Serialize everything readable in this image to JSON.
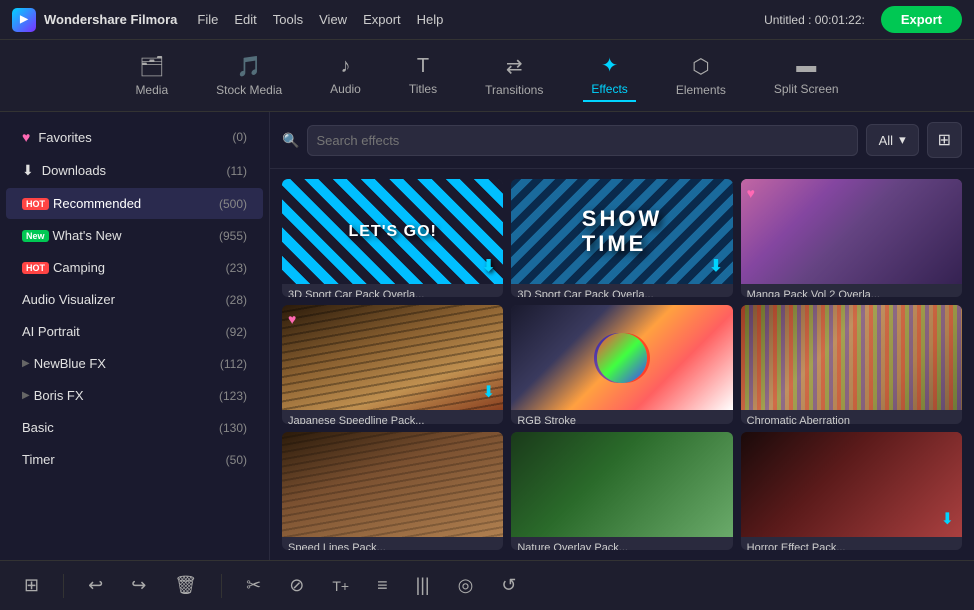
{
  "titleBar": {
    "appName": "Wondershare Filmora",
    "menuItems": [
      "File",
      "Edit",
      "Tools",
      "View",
      "Export",
      "Help"
    ],
    "projectTitle": "Untitled : 00:01:22:",
    "exportLabel": "Export"
  },
  "toolbar": {
    "items": [
      {
        "id": "media",
        "label": "Media",
        "icon": "☰"
      },
      {
        "id": "stock-media",
        "label": "Stock Media",
        "icon": "🎵"
      },
      {
        "id": "audio",
        "label": "Audio",
        "icon": "♪"
      },
      {
        "id": "titles",
        "label": "Titles",
        "icon": "T"
      },
      {
        "id": "transitions",
        "label": "Transitions",
        "icon": "⇄"
      },
      {
        "id": "effects",
        "label": "Effects",
        "icon": "✦",
        "active": true
      },
      {
        "id": "elements",
        "label": "Elements",
        "icon": "⬡"
      },
      {
        "id": "split-screen",
        "label": "Split Screen",
        "icon": "⬜"
      }
    ]
  },
  "sidebar": {
    "items": [
      {
        "id": "favorites",
        "label": "Favorites",
        "count": "(0)",
        "icon": "♥"
      },
      {
        "id": "downloads",
        "label": "Downloads",
        "count": "(11)",
        "icon": "⬇"
      },
      {
        "id": "recommended",
        "label": "Recommended",
        "count": "(500)",
        "badge": "HOT",
        "badgeType": "hot"
      },
      {
        "id": "whats-new",
        "label": "What's New",
        "count": "(955)",
        "badge": "New",
        "badgeType": "new"
      },
      {
        "id": "camping",
        "label": "Camping",
        "count": "(23)",
        "badge": "HOT",
        "badgeType": "hot"
      },
      {
        "id": "audio-visualizer",
        "label": "Audio Visualizer",
        "count": "(28)"
      },
      {
        "id": "ai-portrait",
        "label": "AI Portrait",
        "count": "(92)"
      },
      {
        "id": "newblue-fx",
        "label": "NewBlue FX",
        "count": "(112)",
        "expand": true
      },
      {
        "id": "boris-fx",
        "label": "Boris FX",
        "count": "(123)",
        "expand": true
      },
      {
        "id": "basic",
        "label": "Basic",
        "count": "(130)"
      },
      {
        "id": "timer",
        "label": "Timer",
        "count": "(50)"
      }
    ]
  },
  "search": {
    "placeholder": "Search effects",
    "filterLabel": "All"
  },
  "effects": {
    "items": [
      {
        "id": "sport1",
        "label": "3D Sport Car Pack Overla...",
        "thumbType": "sport1",
        "hasHeart": false,
        "hasDownload": true
      },
      {
        "id": "sport2",
        "label": "3D Sport Car Pack Overla...",
        "thumbType": "sport2",
        "hasHeart": false,
        "hasDownload": true
      },
      {
        "id": "manga",
        "label": "Manga Pack Vol 2 Overla...",
        "thumbType": "manga",
        "hasHeart": true,
        "hasDownload": false
      },
      {
        "id": "japanese",
        "label": "Japanese Speedline Pack...",
        "thumbType": "japanese",
        "hasHeart": true,
        "hasDownload": true
      },
      {
        "id": "rgb",
        "label": "RGB Stroke",
        "thumbType": "rgb",
        "hasHeart": false,
        "hasDownload": false
      },
      {
        "id": "chromatic",
        "label": "Chromatic Aberration",
        "thumbType": "chromatic",
        "hasHeart": false,
        "hasDownload": false
      },
      {
        "id": "row4-1",
        "label": "Speed Lines Pack...",
        "thumbType": "row4-1",
        "hasHeart": false,
        "hasDownload": false
      },
      {
        "id": "row4-2",
        "label": "Nature Overlay Pack...",
        "thumbType": "row4-2",
        "hasHeart": false,
        "hasDownload": false
      },
      {
        "id": "row4-3",
        "label": "Horror Effect Pack...",
        "thumbType": "row4-3",
        "hasHeart": false,
        "hasDownload": true
      }
    ]
  },
  "bottomTools": {
    "icons": [
      "⊞",
      "↩",
      "↪",
      "🗑",
      "✂",
      "⊘",
      "T+",
      "≡",
      "|||",
      "◎",
      "↺"
    ]
  }
}
